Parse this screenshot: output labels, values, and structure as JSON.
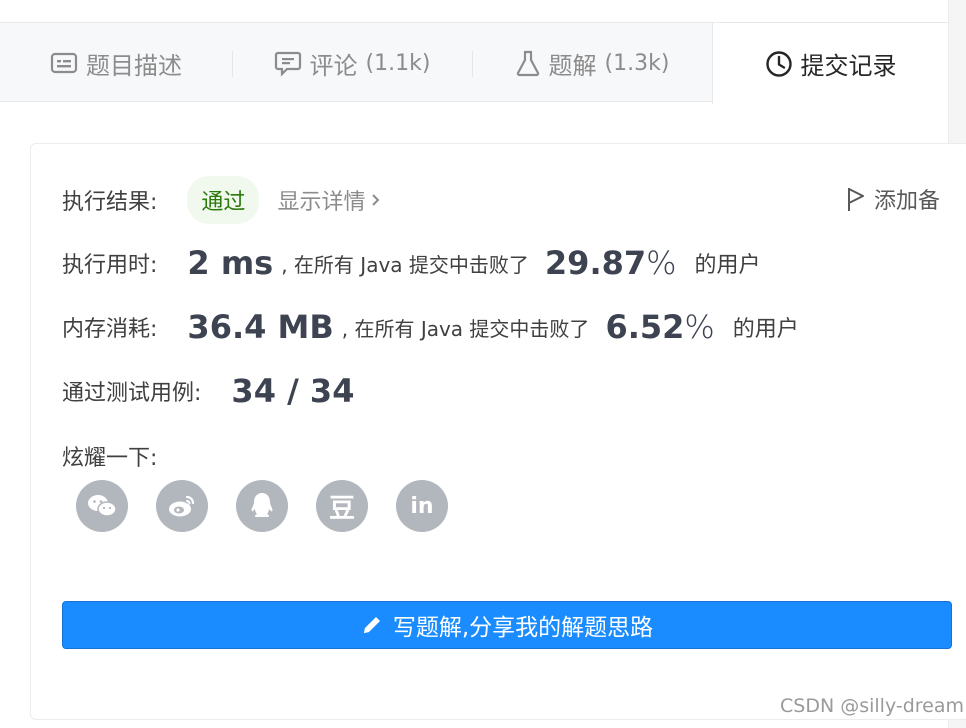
{
  "tabs": [
    {
      "label": "题目描述",
      "count": "",
      "icon": "description-icon",
      "active": false
    },
    {
      "label": "评论",
      "count": "(1.1k)",
      "icon": "comment-icon",
      "active": false
    },
    {
      "label": "题解",
      "count": "(1.3k)",
      "icon": "flask-icon",
      "active": false
    },
    {
      "label": "提交记录",
      "count": "",
      "icon": "clock-icon",
      "active": true
    }
  ],
  "result": {
    "label": "执行结果:",
    "status": "通过",
    "details_link": "显示详情",
    "add_note": "添加备"
  },
  "runtime": {
    "label": "执行用时:",
    "value": "2 ms",
    "beat_text": ", 在所有 Java 提交中击败了",
    "percent": "29.87",
    "percent_sign": "%",
    "suffix": "的用户"
  },
  "memory": {
    "label": "内存消耗:",
    "value": "36.4 MB",
    "beat_text": ", 在所有 Java 提交中击败了",
    "percent": "6.52",
    "percent_sign": "%",
    "suffix": "的用户"
  },
  "testcases": {
    "label": "通过测试用例:",
    "value": "34 / 34"
  },
  "share": {
    "label": "炫耀一下:",
    "items": [
      "wechat-icon",
      "weibo-icon",
      "qq-icon",
      "douban-icon",
      "linkedin-icon"
    ],
    "douban_glyph": "豆",
    "linkedin_glyph": "in"
  },
  "write_button": "写题解,分享我的解题思路",
  "watermark": "CSDN @silly-dream",
  "colors": {
    "accent": "#1a8cff",
    "success_text": "#2b7a0b",
    "success_bg": "#f1f8ed",
    "icon_gray": "#b2b6bd"
  }
}
